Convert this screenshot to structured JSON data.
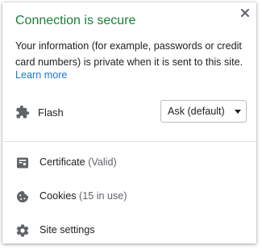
{
  "header": {
    "title": "Connection is secure",
    "close_label": "×"
  },
  "description": "Your information (for example, passwords or credit card numbers) is private when it is sent to this site.",
  "learn_more": "Learn more",
  "permission": {
    "label": "Flash",
    "icon": "puzzle-piece-icon",
    "selected": "Ask (default)"
  },
  "items": [
    {
      "label": "Certificate",
      "detail": "(Valid)",
      "icon": "certificate-icon"
    },
    {
      "label": "Cookies",
      "detail": "(15 in use)",
      "icon": "cookie-icon"
    },
    {
      "label": "Site settings",
      "detail": "",
      "icon": "gear-icon"
    }
  ],
  "colors": {
    "title": "#188038",
    "link": "#1a73e8",
    "icon": "#5f6368"
  }
}
